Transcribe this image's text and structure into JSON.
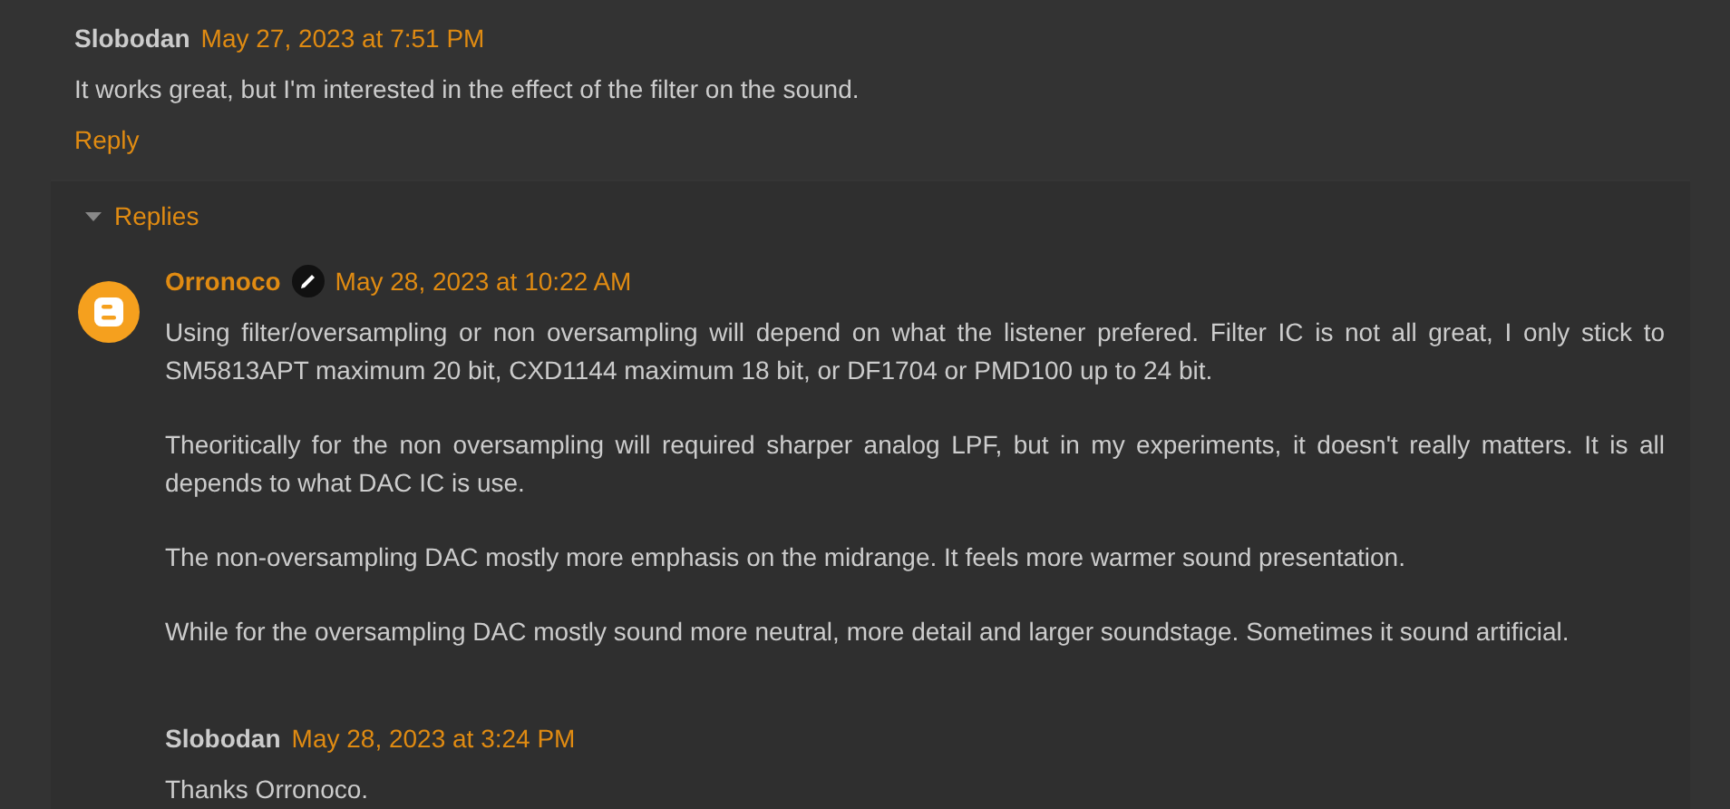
{
  "comment": {
    "author": "Slobodan",
    "date": "May 27, 2023 at 7:51 PM",
    "text": "It works great, but I'm interested in the effect of the filter on the sound.",
    "reply_link": "Reply"
  },
  "replies": {
    "toggle": "Replies",
    "expanded": true,
    "items": [
      {
        "author": "Orronoco",
        "is_admin": true,
        "has_avatar": true,
        "date": "May 28, 2023 at 10:22 AM",
        "paragraphs": [
          "Using filter/oversampling or non oversampling will depend on what the listener prefered. Filter IC is not all great, I only stick to SM5813APT maximum 20 bit, CXD1144 maximum 18 bit, or DF1704 or PMD100 up to 24 bit.",
          "Theoritically for the non oversampling will required sharper analog LPF, but in my experiments, it doesn't really matters. It is all depends to what DAC IC is use.",
          "The non-oversampling DAC mostly more emphasis on the midrange. It feels more warmer sound presentation.",
          "While for the oversampling DAC mostly sound more neutral, more detail and larger soundstage. Sometimes it sound artificial."
        ]
      },
      {
        "author": "Slobodan",
        "is_admin": false,
        "has_avatar": false,
        "date": "May 28, 2023 at 3:24 PM",
        "paragraphs": [
          "Thanks Orronoco."
        ]
      }
    ]
  }
}
